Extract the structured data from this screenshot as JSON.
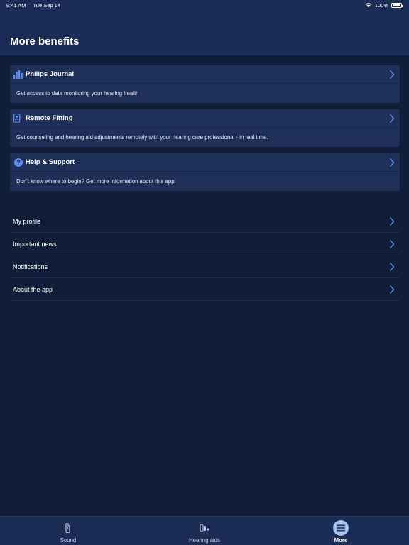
{
  "status": {
    "time": "9:41 AM",
    "date": "Tue Sep 14",
    "battery": "100%"
  },
  "page": {
    "title": "More benefits"
  },
  "cards": [
    {
      "title": "Philips Journal",
      "description": "Get access to data monitoring your hearing health",
      "icon": "bar-chart-icon"
    },
    {
      "title": "Remote Fitting",
      "description": "Get counseling and hearing aid adjustments remotely with your hearing care professional - in real time.",
      "icon": "remote-fitting-icon"
    },
    {
      "title": "Help & Support",
      "description": "Don't know where to begin? Get more information about this app.",
      "icon": "help-icon"
    }
  ],
  "list": [
    {
      "label": "My profile"
    },
    {
      "label": "Important news"
    },
    {
      "label": "Notifications"
    },
    {
      "label": "About the app"
    }
  ],
  "tabs": [
    {
      "label": "Sound",
      "icon": "sound-icon",
      "active": false
    },
    {
      "label": "Hearing aids",
      "icon": "hearing-aids-icon",
      "active": false
    },
    {
      "label": "More",
      "icon": "menu-icon",
      "active": true
    }
  ],
  "colors": {
    "background": "#111e3a",
    "header": "#1b2d56",
    "card": "#1e2f58",
    "accent": "#5b8ef0"
  }
}
